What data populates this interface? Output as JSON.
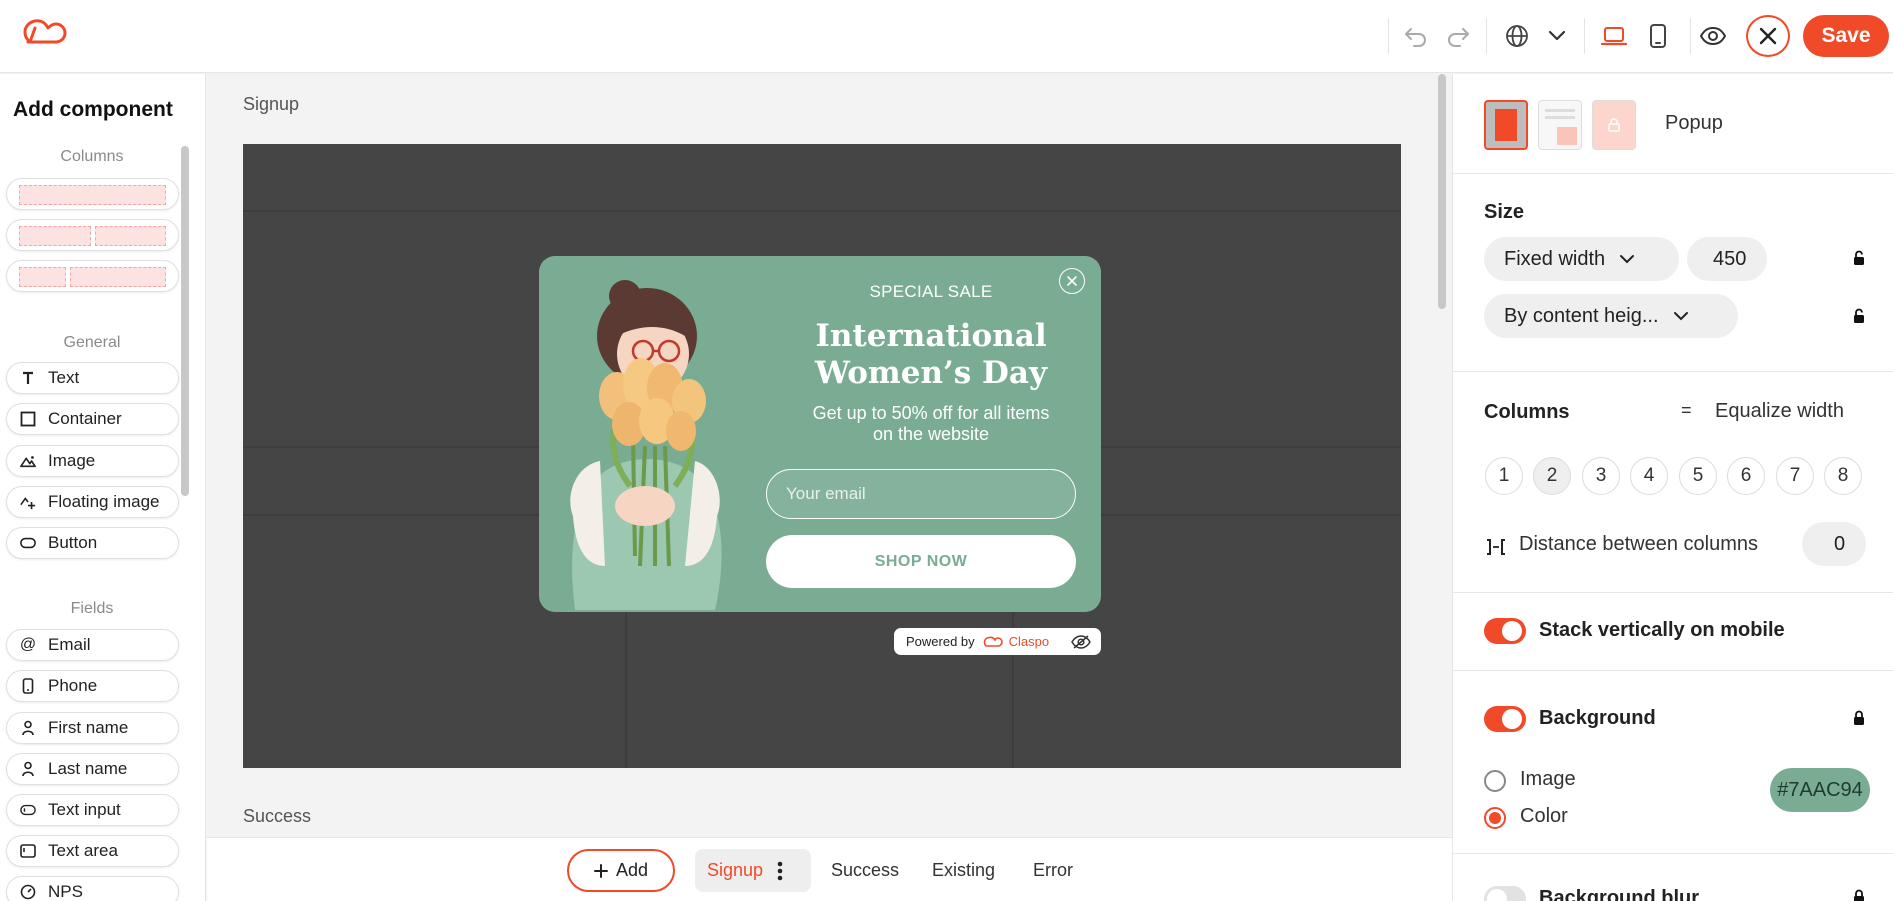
{
  "toolbar": {
    "save_label": "Save",
    "icons": [
      "undo-icon",
      "redo-icon",
      "globe-icon",
      "chevron-down-icon",
      "desktop-icon",
      "mobile-icon",
      "eye-icon",
      "close-icon"
    ]
  },
  "left_panel": {
    "title": "Add component",
    "columns_section": "Columns",
    "general_section": "General",
    "general_items": [
      "Text",
      "Container",
      "Image",
      "Floating image",
      "Button"
    ],
    "fields_section": "Fields",
    "field_items": [
      "Email",
      "Phone",
      "First name",
      "Last name",
      "Text input",
      "Text area",
      "NPS"
    ]
  },
  "canvas": {
    "signup_label": "Signup",
    "success_label": "Success",
    "popup": {
      "kicker": "SPECIAL SALE",
      "title_line1": "International",
      "title_line2": "Women’s Day",
      "desc_line1": "Get up to 50% off for all items",
      "desc_line2": "on the website",
      "email_placeholder": "Your email",
      "cta": "SHOP NOW"
    },
    "powered": {
      "prefix": "Powered by",
      "brand": "Claspo"
    }
  },
  "bottom_tabs": {
    "add_label": "Add",
    "tabs": [
      "Signup",
      "Success",
      "Existing",
      "Error"
    ],
    "active": "Signup"
  },
  "right_panel": {
    "popup_label": "Popup",
    "size_heading": "Size",
    "width_mode": "Fixed width",
    "width_value": "450",
    "height_mode": "By content heig...",
    "columns_heading": "Columns",
    "equalize_label": "Equalize width",
    "column_numbers": [
      "1",
      "2",
      "3",
      "4",
      "5",
      "6",
      "7",
      "8"
    ],
    "selected_columns": "2",
    "distance_label": "Distance between columns",
    "distance_value": "0",
    "stack_label": "Stack vertically on mobile",
    "stack_on": true,
    "background_label": "Background",
    "background_on": true,
    "bg_image_label": "Image",
    "bg_color_label": "Color",
    "bg_selected": "Color",
    "bg_color_value": "#7AAC94",
    "blur_label": "Background blur"
  },
  "colors": {
    "accent": "#F04A28",
    "popup_bg": "#7AAC94",
    "canvas_bg": "#454545"
  }
}
